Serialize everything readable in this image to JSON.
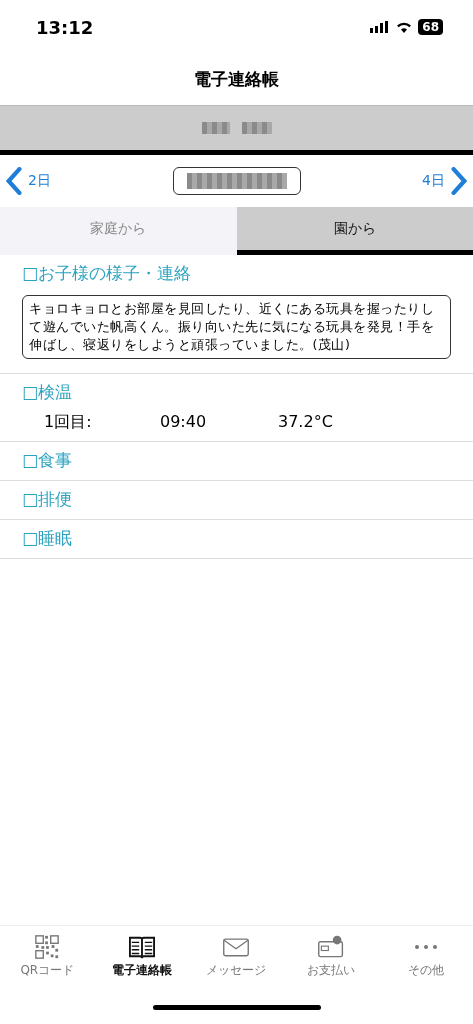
{
  "status_bar": {
    "time": "13:12",
    "battery": "68"
  },
  "header": {
    "title": "電子連絡帳"
  },
  "date_nav": {
    "prev": "2日",
    "next": "4日"
  },
  "tabs": [
    {
      "label": "家庭から",
      "selected": false
    },
    {
      "label": "園から",
      "selected": true
    }
  ],
  "sections": [
    {
      "kind": "note",
      "title": "□お子様の様子・連絡",
      "text": "キョロキョロとお部屋を見回したり、近くにある玩具を握ったりして遊んでいた帆高くん。振り向いた先に気になる玩具を発見！手を伸ばし、寝返りをしようと頑張っていました。(茂山)"
    },
    {
      "kind": "readings",
      "title": "□検温",
      "rows": [
        {
          "label": "1回目:",
          "time": "09:40",
          "value": "37.2°C"
        }
      ]
    },
    {
      "kind": "empty",
      "title": "□食事"
    },
    {
      "kind": "empty",
      "title": "□排便"
    },
    {
      "kind": "empty",
      "title": "□睡眠"
    }
  ],
  "bottom_nav": [
    {
      "kind": "qr",
      "label": "QRコード",
      "selected": false
    },
    {
      "kind": "book",
      "label": "電子連絡帳",
      "selected": true
    },
    {
      "kind": "mail",
      "label": "メッセージ",
      "selected": false
    },
    {
      "kind": "wallet",
      "label": "お支払い",
      "selected": false
    },
    {
      "kind": "more",
      "label": "その他",
      "selected": false
    }
  ]
}
